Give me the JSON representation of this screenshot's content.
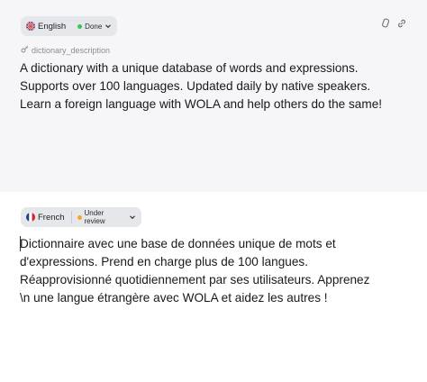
{
  "source": {
    "language": "English",
    "status": "Done",
    "status_color": "#34c759",
    "key_label": "dictionary_description",
    "text_lines": [
      "A dictionary with a unique database of words and expressions.",
      "Supports over 100 languages. Updated daily by native speakers.",
      "Learn a foreign language with WOLA and help others do the same!"
    ],
    "flag_icon": "uk-flag-icon",
    "toolbar_icons": [
      "copy-icon",
      "link-icon"
    ]
  },
  "translation": {
    "language": "French",
    "status": "Under review",
    "status_color": "#f5a623",
    "flag_icon": "france-flag-icon",
    "text_lines": [
      "Dictionnaire avec une base de données unique de mots et",
      "d'expressions. Prend en charge plus de 100 langues.",
      "Réapprovisionné quotidiennement par ses utilisateurs. Apprenez",
      "\\n une langue étrangère avec WOLA et aidez les autres !"
    ]
  },
  "colors": {
    "top_panel_bg": "#f6f6f8",
    "pill_bg": "#e6e7ea"
  }
}
